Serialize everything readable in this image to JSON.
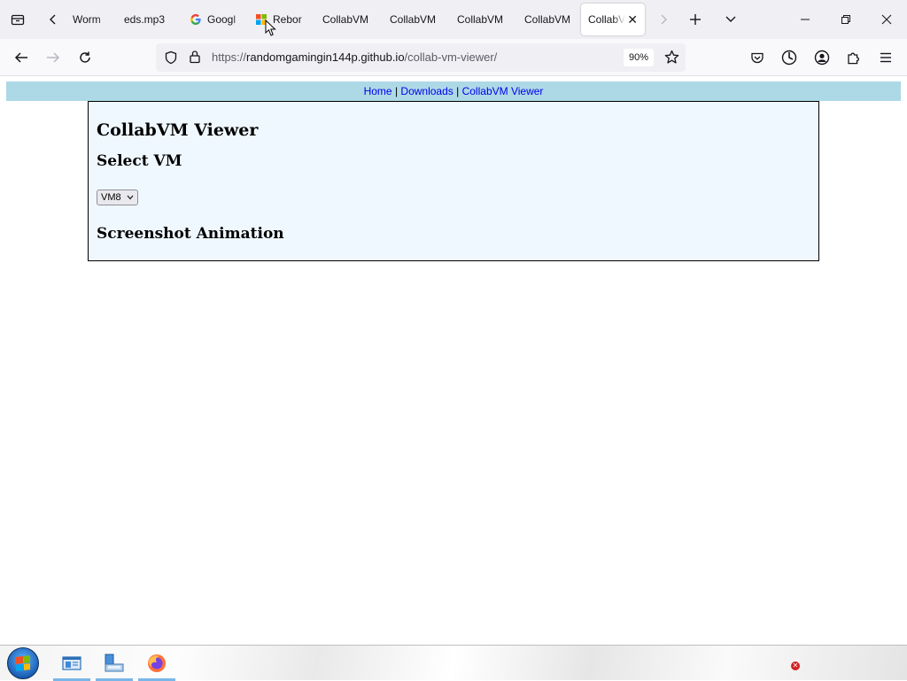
{
  "browser": {
    "tabs": [
      {
        "label": "Worm",
        "favicon": "none"
      },
      {
        "label": "eds.mp3",
        "favicon": "none"
      },
      {
        "label": "Googl",
        "favicon": "google-icon"
      },
      {
        "label": "Rebor",
        "favicon": "windows-logo-icon"
      },
      {
        "label": "CollabVM",
        "favicon": "none"
      },
      {
        "label": "CollabVM",
        "favicon": "none"
      },
      {
        "label": "CollabVM",
        "favicon": "none"
      },
      {
        "label": "CollabVM",
        "favicon": "none"
      },
      {
        "label": "CollabV",
        "favicon": "none",
        "active": true
      }
    ],
    "url": {
      "prefix": "https://",
      "host": "randomgamingin144p.github.io",
      "path": "/collab-vm-viewer/"
    },
    "zoom": "90%"
  },
  "site": {
    "nav": {
      "home": "Home",
      "sep1": "|",
      "downloads": "Downloads",
      "sep2": "|",
      "viewer": "CollabVM Viewer"
    },
    "title": "CollabVM Viewer",
    "select_heading": "Select VM",
    "vm_selected": "VM8",
    "animation_heading": "Screenshot Animation"
  },
  "colors": {
    "nav_bg": "#add8e6",
    "panel_bg": "#f0f8ff",
    "link": "#0000ee"
  }
}
